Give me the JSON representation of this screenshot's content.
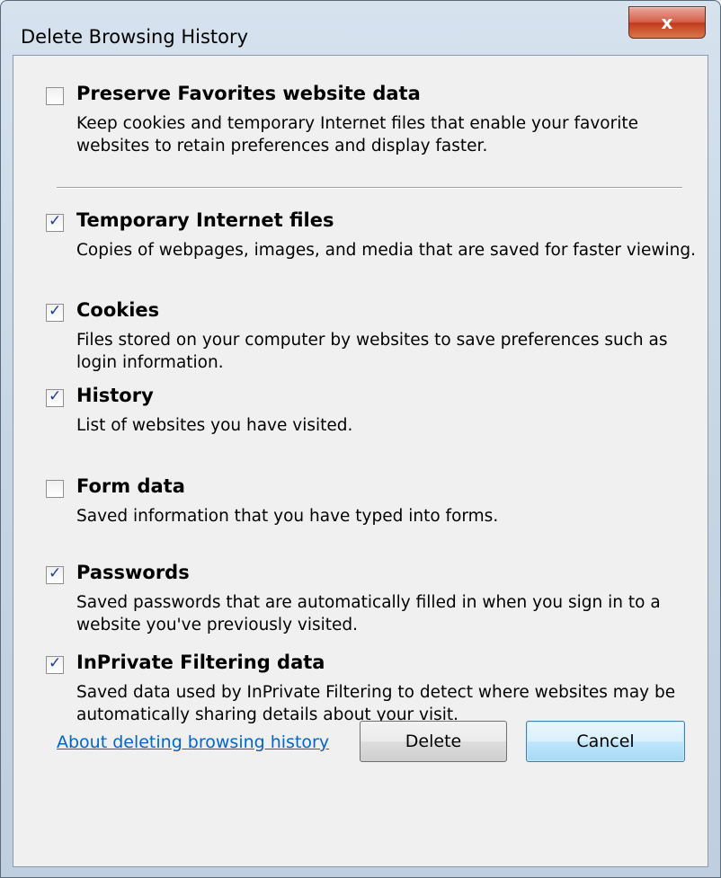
{
  "window": {
    "title": "Delete Browsing History",
    "close_glyph": "x"
  },
  "options": [
    {
      "label": "Preserve Favorites website data",
      "checked": false,
      "description": "Keep cookies and temporary Internet files that enable your favorite websites to retain preferences and display faster."
    },
    {
      "label": "Temporary Internet files",
      "checked": true,
      "description": "Copies of webpages, images, and media that are saved for faster viewing."
    },
    {
      "label": "Cookies",
      "checked": true,
      "description": "Files stored on your computer by websites to save preferences such as login information."
    },
    {
      "label": "History",
      "checked": true,
      "description": "List of websites you have visited."
    },
    {
      "label": "Form data",
      "checked": false,
      "description": "Saved information that you have typed into forms."
    },
    {
      "label": "Passwords",
      "checked": true,
      "description": "Saved passwords that are automatically filled in when you sign in to a website you've previously visited."
    },
    {
      "label": "InPrivate Filtering data",
      "checked": true,
      "description": "Saved data used by InPrivate Filtering to detect where websites may be automatically sharing details about your visit."
    }
  ],
  "footer": {
    "about_link": "About deleting browsing history",
    "delete_label": "Delete",
    "cancel_label": "Cancel"
  },
  "colors": {
    "link": "#0066cc",
    "close_button": "#c23a1e",
    "check_mark": "#1c3f94"
  }
}
